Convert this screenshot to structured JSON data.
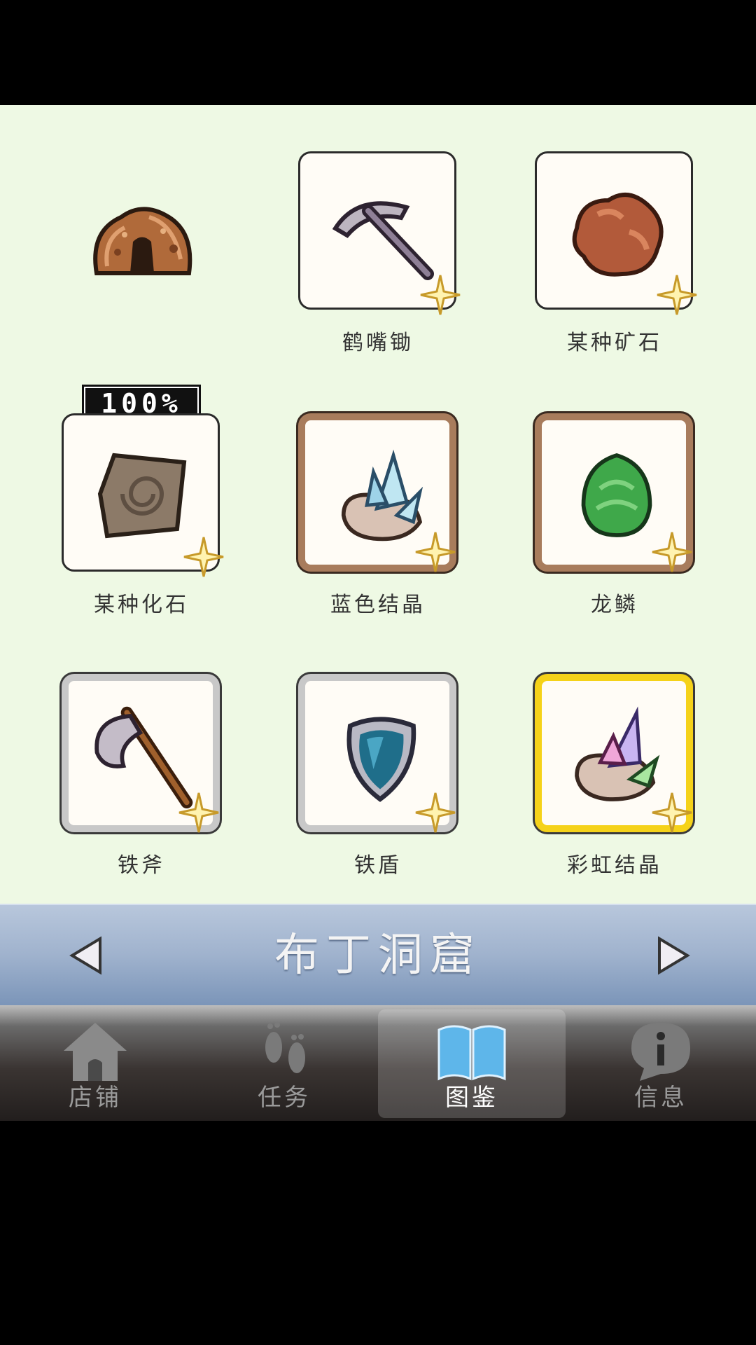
{
  "collection": {
    "completion": "100%",
    "items": [
      {
        "name": "鹤嘴锄",
        "icon": "pickaxe-icon",
        "frame": "plain"
      },
      {
        "name": "某种矿石",
        "icon": "ore-icon",
        "frame": "plain"
      },
      {
        "name": "某种化石",
        "icon": "fossil-icon",
        "frame": "plain"
      },
      {
        "name": "蓝色结晶",
        "icon": "blue-crystal-icon",
        "frame": "brown"
      },
      {
        "name": "龙鳞",
        "icon": "dragon-scale-icon",
        "frame": "brown"
      },
      {
        "name": "铁斧",
        "icon": "iron-axe-icon",
        "frame": "gray"
      },
      {
        "name": "铁盾",
        "icon": "iron-shield-icon",
        "frame": "gray"
      },
      {
        "name": "彩虹结晶",
        "icon": "rainbow-crystal-icon",
        "frame": "gold"
      }
    ]
  },
  "region": {
    "title": "布丁洞窟",
    "prev_icon": "left-arrow-icon",
    "next_icon": "right-arrow-icon"
  },
  "tabs": [
    {
      "label": "店铺",
      "icon": "house-icon",
      "active": false
    },
    {
      "label": "任务",
      "icon": "footprints-icon",
      "active": false
    },
    {
      "label": "图鉴",
      "icon": "book-icon",
      "active": true
    },
    {
      "label": "信息",
      "icon": "info-bubble-icon",
      "active": false
    }
  ],
  "colors": {
    "background": "#eef9e4",
    "frame_brown": "#a87c5c",
    "frame_gray": "#c8c8c8",
    "frame_gold": "#f5d219",
    "tab_active_label": "#ffffff",
    "tab_inactive_label": "#9a9a9a"
  }
}
